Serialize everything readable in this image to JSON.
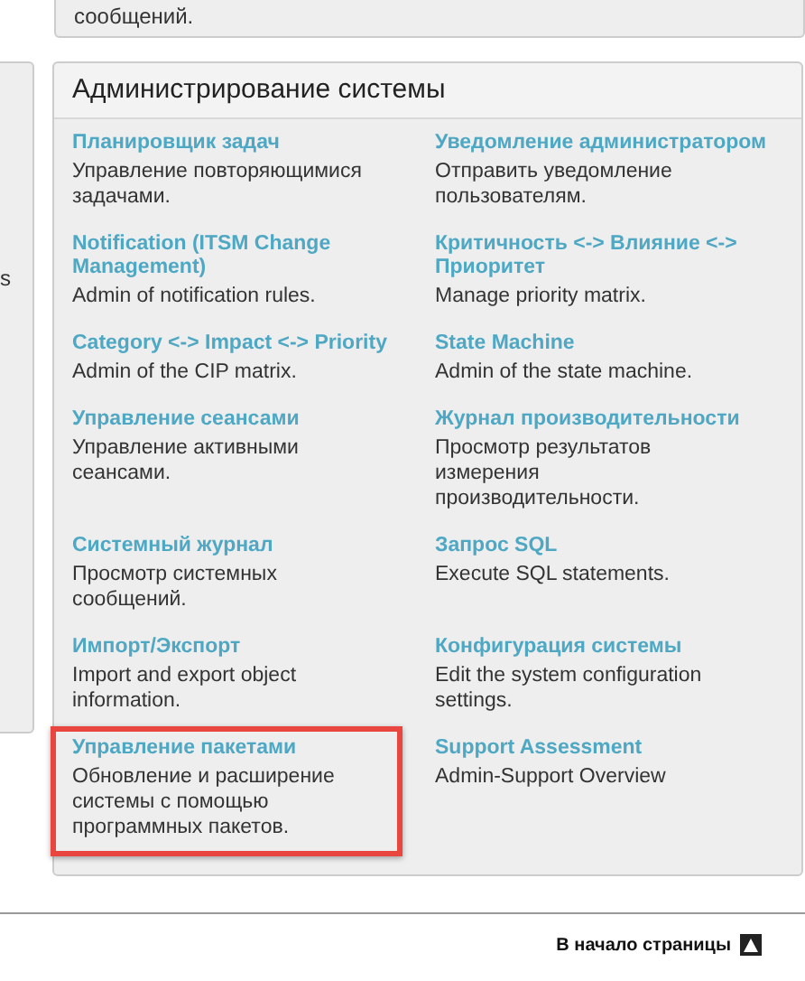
{
  "top_card": {
    "text": "сообщений."
  },
  "left_panel": {
    "text": "s"
  },
  "admin_panel": {
    "title": "Администрирование системы",
    "items": [
      {
        "title": "Планировщик задач",
        "description": "Управление повторяющимися задачами.",
        "highlighted": false
      },
      {
        "title": "Уведомление администратором",
        "description": "Отправить уведомление пользователям.",
        "highlighted": false
      },
      {
        "title": "Notification (ITSM Change Management)",
        "description": "Admin of notification rules.",
        "highlighted": false
      },
      {
        "title": "Критичность <-> Влияние <-> Приоритет",
        "description": "Manage priority matrix.",
        "highlighted": false
      },
      {
        "title": "Category <-> Impact <-> Priority",
        "description": "Admin of the CIP matrix.",
        "highlighted": false
      },
      {
        "title": "State Machine",
        "description": "Admin of the state machine.",
        "highlighted": false
      },
      {
        "title": "Управление сеансами",
        "description": "Управление активными сеансами.",
        "highlighted": false
      },
      {
        "title": "Журнал производительности",
        "description": "Просмотр результатов измерения производительности.",
        "highlighted": false
      },
      {
        "title": "Системный журнал",
        "description": "Просмотр системных сообщений.",
        "highlighted": false
      },
      {
        "title": "Запрос SQL",
        "description": "Execute SQL statements.",
        "highlighted": false
      },
      {
        "title": "Импорт/Экспорт",
        "description": "Import and export object information.",
        "highlighted": false
      },
      {
        "title": "Конфигурация системы",
        "description": "Edit the system configuration settings.",
        "highlighted": false
      },
      {
        "title": "Управление пакетами",
        "description": "Обновление и расширение системы с помощью программных пакетов.",
        "highlighted": true
      },
      {
        "title": "Support Assessment",
        "description": "Admin-Support Overview",
        "highlighted": false
      }
    ]
  },
  "footer": {
    "top_link": "В начало страницы"
  }
}
